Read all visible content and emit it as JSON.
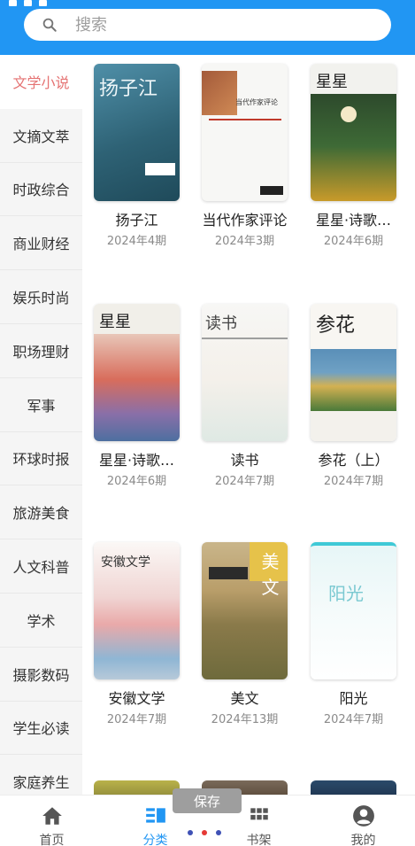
{
  "search": {
    "placeholder": "搜索",
    "icon": "search-icon"
  },
  "sidebar": {
    "items": [
      {
        "label": "文学小说",
        "active": true
      },
      {
        "label": "文摘文萃"
      },
      {
        "label": "时政综合"
      },
      {
        "label": "商业财经"
      },
      {
        "label": "娱乐时尚"
      },
      {
        "label": "职场理财"
      },
      {
        "label": "军事"
      },
      {
        "label": "环球时报"
      },
      {
        "label": "旅游美食"
      },
      {
        "label": "人文科普"
      },
      {
        "label": "学术"
      },
      {
        "label": "摄影数码"
      },
      {
        "label": "学生必读"
      },
      {
        "label": "家庭养生"
      }
    ]
  },
  "books": [
    {
      "title": "扬子江",
      "issue": "2024年4期",
      "cover_text": "扬子江"
    },
    {
      "title": "当代作家评论",
      "issue": "2024年3期",
      "cover_text": "当代作家评论"
    },
    {
      "title": "星星·诗歌…",
      "issue": "2024年6期",
      "cover_text": "星星"
    },
    {
      "title": "星星·诗歌…",
      "issue": "2024年6期",
      "cover_text": "星星"
    },
    {
      "title": "读书",
      "issue": "2024年7期",
      "cover_text": "读书"
    },
    {
      "title": "参花（上）",
      "issue": "2024年7期",
      "cover_text": "参花"
    },
    {
      "title": "安徽文学",
      "issue": "2024年7期",
      "cover_text": "安徽文学"
    },
    {
      "title": "美文",
      "issue": "2024年13期",
      "cover_text": "美文"
    },
    {
      "title": "阳光",
      "issue": "2024年7期",
      "cover_text": "阳光"
    }
  ],
  "nav": {
    "items": [
      {
        "label": "首页",
        "icon": "home-icon"
      },
      {
        "label": "分类",
        "icon": "category-icon",
        "active": true
      },
      {
        "label": "书架",
        "icon": "bookshelf-icon"
      },
      {
        "label": "我的",
        "icon": "profile-icon"
      }
    ]
  },
  "toast": {
    "label": "保存"
  },
  "colors": {
    "primary": "#2196f3",
    "sidebar_active": "#e57373",
    "dot_blue": "#3f51b5",
    "dot_red": "#e53935"
  }
}
